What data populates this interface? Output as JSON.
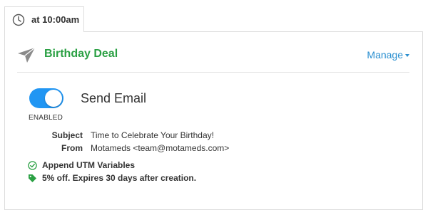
{
  "schedule": {
    "time_label": "at 10:00am",
    "icon": "clock-icon"
  },
  "campaign": {
    "title": "Birthday Deal",
    "title_color": "#2aa043",
    "icon": "paper-plane-icon",
    "manage_label": "Manage"
  },
  "action": {
    "title": "Send Email",
    "status_label": "ENABLED",
    "enabled": true,
    "toggle_color": "#2196f3"
  },
  "email": {
    "subject_label": "Subject",
    "subject_value": "Time to Celebrate Your Birthday!",
    "from_label": "From",
    "from_value": "Motameds <team@motameds.com>"
  },
  "features": [
    {
      "label": "Append UTM Variables",
      "icon": "check-circle-icon"
    },
    {
      "label": "5% off. Expires 30 days after creation.",
      "icon": "tag-icon"
    }
  ],
  "colors": {
    "accent_green": "#2aa043",
    "link_blue": "#2a8fd0"
  }
}
